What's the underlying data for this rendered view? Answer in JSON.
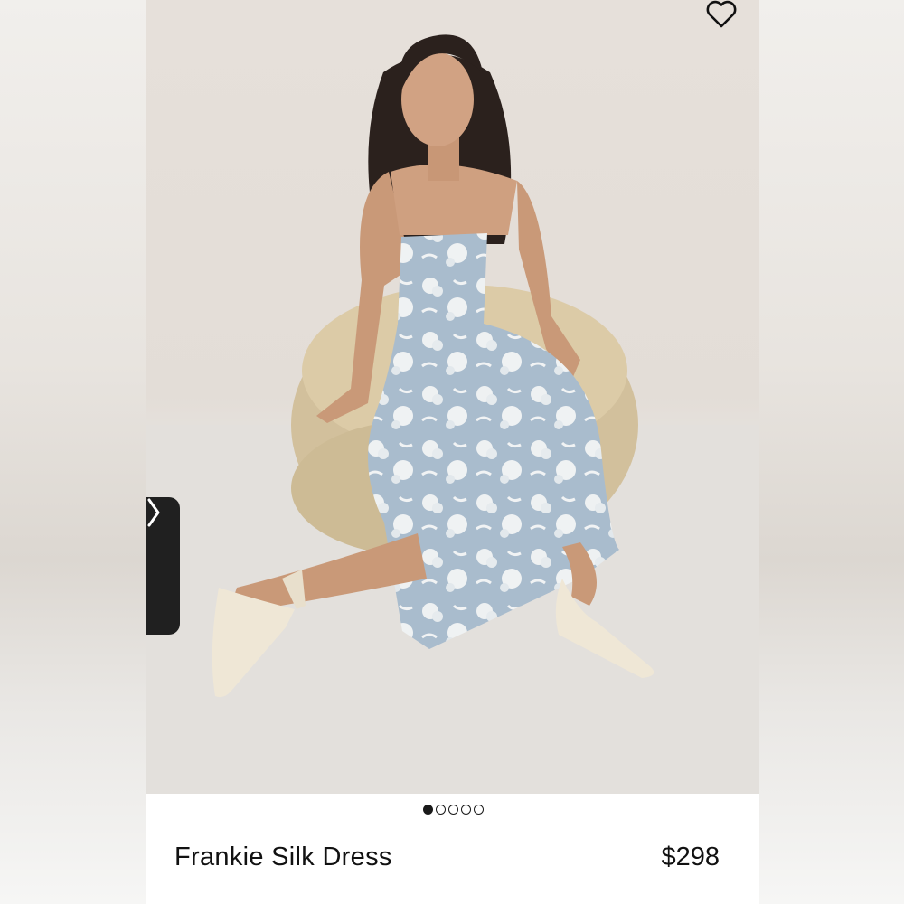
{
  "product": {
    "name": "Frankie Silk Dress",
    "price": "$298"
  },
  "carousel": {
    "total_images": 5,
    "active_index": 0
  },
  "icons": {
    "favorite": "heart-outline-icon",
    "next": "chevron-right-icon"
  },
  "colors": {
    "dress": "#a9bccd",
    "chair": "#d4c29f",
    "background": "#e4ded8",
    "text": "#111111"
  }
}
